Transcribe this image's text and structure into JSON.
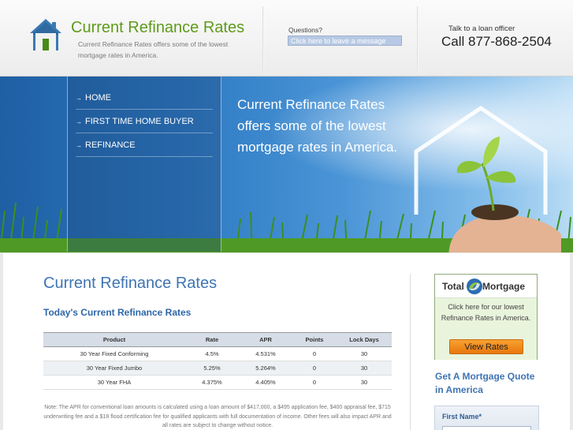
{
  "header": {
    "site_title": "Current Refinance Rates",
    "tagline": "Current Refinance Rates offers some of the lowest mortgage rates in America.",
    "questions_label": "Questions?",
    "message_link": "Click here to leave a message",
    "talk_label": "Talk to a loan officer",
    "phone": "Call 877-868-2504"
  },
  "nav": {
    "items": [
      {
        "label": "HOME"
      },
      {
        "label": "FIRST TIME HOME BUYER"
      },
      {
        "label": "REFINANCE"
      }
    ],
    "arrow": "→"
  },
  "banner": {
    "headline": "Current Refinance Rates offers some of the lowest mortgage rates in America."
  },
  "main": {
    "page_title": "Current Refinance Rates",
    "section_title": "Today's Current Refinance Rates",
    "table": {
      "headers": [
        "Product",
        "Rate",
        "APR",
        "Points",
        "Lock Days"
      ],
      "rows": [
        [
          "30 Year Fixed Conforming",
          "4.5%",
          "4.531%",
          "0",
          "30"
        ],
        [
          "30 Year Fixed Jumbo",
          "5.25%",
          "5.264%",
          "0",
          "30"
        ],
        [
          "30 Year FHA",
          "4.375%",
          "4.405%",
          "0",
          "30"
        ]
      ]
    },
    "note": "Note: The APR for conventional loan amounts is calculated using a loan amount of $417,000, a $495 application fee, $400 appraisal fee, $715 underwriting fee and a $18 flood certification fee for qualified applicants with full documentation of income. Other fees will also impact APR and all rates are subject to change without notice."
  },
  "sidebar": {
    "promo": {
      "brand_part1": "Total",
      "brand_part2": "Mortgage",
      "text": "Click here for our lowest Refinance Rates in America.",
      "button": "View Rates"
    },
    "quote_heading": "Get A Mortgage Quote in America",
    "form": {
      "first_name_label": "First Name*",
      "first_name_value": ""
    }
  },
  "colors": {
    "brand_green": "#5e9b1b",
    "heading_blue": "#3f74b3",
    "button_orange": "#f08a1e"
  }
}
